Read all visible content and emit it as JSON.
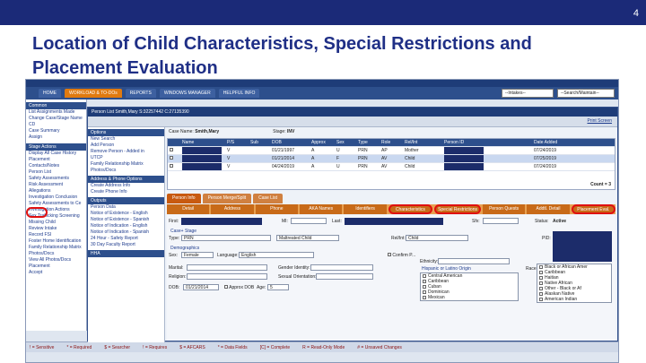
{
  "slide": {
    "number": "4",
    "title": "Location of Child Characteristics, Special Restrictions and Placement Evaluation"
  },
  "app": {
    "nav_tabs": [
      "HOME",
      "WORKLOAD & TO-DOs",
      "REPORTS",
      "WINDOWS MANAGER",
      "HELPFUL INFO"
    ],
    "intakes_select": "--Intakes--",
    "search_select": "--Search/Maintain--"
  },
  "left_panel": {
    "common_header": "Common",
    "common_items": [
      "List Assignments Made",
      "Change Case/Stage Name",
      "CD",
      "Case Summary",
      "Assign"
    ],
    "stage_header": "Stage Actions",
    "stage_items": [
      "Display All Case History",
      "Placement",
      "Contacts/Notes",
      "Person List",
      "Safety Assessments",
      "Risk Assessment",
      "Allegations",
      "Investigation Conclusion",
      "Safety Assessments to Ce",
      "Investigation Actions",
      "Sex Trafficking Screening",
      "Missing Child",
      "Review Intake",
      "Record FSI",
      "Foster Home Identification",
      "Family Relationship Matrix",
      "Photos/Docs",
      "View All Photos/Docs",
      "Placement",
      "Accept"
    ]
  },
  "legend": [
    "! = Sensitive",
    "* = Required",
    "$ = Searcher",
    "! = Requires",
    "$ = AFCARS",
    "* = Data Fields",
    "[C] = Complete",
    "R = Read-Only Mode",
    "# = Unsaved Changes"
  ],
  "person_window": {
    "title": "Person List   Smith,Mary   S:32257442 C:27135390",
    "print_screen": "Print Screen",
    "case_name_label": "Case Name:",
    "case_name": "Smith,Mary",
    "stage_label": "Stage:",
    "stage": "INV",
    "left_sections": [
      {
        "header": "Options",
        "items": [
          "New Search",
          "Add Person",
          "Remove Person - Added in",
          "UTCP",
          "Family Relationship Matrix",
          "Photos/Docs"
        ]
      },
      {
        "header": "Address & Phone Options",
        "items": [
          "Create Address Info",
          "Create Phone Info"
        ]
      },
      {
        "header": "Outputs",
        "items": [
          "Person Data",
          "Notice of Existence - English",
          "Notice of Existence - Spanish",
          "Notice of Indication - English",
          "Notice of Indication - Spanish",
          "24 Hour - Safety Report",
          "30 Day Faculty Report"
        ]
      },
      {
        "header": "HHA",
        "items": []
      }
    ],
    "grid_headers": [
      "",
      "Name",
      "P/S",
      "Sub",
      "DOB",
      "Approx",
      "Sex",
      "Type",
      "Role",
      "Rel/Int",
      "Person ID",
      "",
      "Date Added"
    ],
    "rows": [
      {
        "ps": "V",
        "dob": "01/21/1997",
        "approx": "A",
        "sex": "U",
        "type": "PRN",
        "role": "AP",
        "rel": "Mother",
        "date": "07/24/2019"
      },
      {
        "ps": "V",
        "dob": "01/21/2014",
        "approx": "A",
        "sex": "F",
        "type": "PRN",
        "role": "AV",
        "rel": "Child",
        "date": "07/25/2019"
      },
      {
        "ps": "V",
        "dob": "04/24/2019",
        "approx": "A",
        "sex": "U",
        "type": "PRN",
        "role": "AV",
        "rel": "Child",
        "date": "07/24/2019"
      }
    ],
    "count_label": "Count = 3",
    "main_tabs": [
      "Person Info",
      "Person Merge/Split",
      "Case List"
    ],
    "sub_tabs": [
      "Detail",
      "Address",
      "Phone",
      "AKA Names",
      "Identifiers",
      "Characteristics",
      "Special Restrictions",
      "Person Quests",
      "Addtl. Detail",
      "Placement Eval."
    ],
    "form": {
      "first_label": "First:",
      "mi_label": "MI:",
      "last_label": "Last:",
      "sfx_label": "Sfx:",
      "status_label": "Status:",
      "status": "Active",
      "case_stage_label": "Case+ Stage",
      "type_label": "Type:",
      "type": "PRN",
      "role_value": "Maltreated Child",
      "rel_label": "Rel/Int:",
      "rel": "Child",
      "pid_label": "PID:",
      "demographics": "Demographics",
      "sex_label": "Sex:",
      "sex": "Female",
      "language_label": "Language:",
      "language": "English",
      "confirm_label": "Confirm P...",
      "ethnicity_label": "Ethnicity:",
      "marital_label": "Marital:",
      "gender_label": "Gender Identity:",
      "religion_label": "Religion:",
      "orientation_label": "Sexual Orientation:",
      "dob_label": "DOB:",
      "dob": "01/21/2014",
      "approx_dob_label": "Approx DOB",
      "age_label": "Age:",
      "age": "5",
      "race_label": "Race",
      "hispanic_header": "Hispanic or Latino Origin",
      "hispanic_options": [
        "Central American",
        "Caribbean",
        "Cuban",
        "Dominican",
        "Mexican"
      ],
      "race_options": [
        "Black or African Amer",
        "Caribbean",
        "Haitian",
        "Native African",
        "Other - Black or Af",
        "Alaskan Native",
        "American Indian"
      ]
    }
  }
}
